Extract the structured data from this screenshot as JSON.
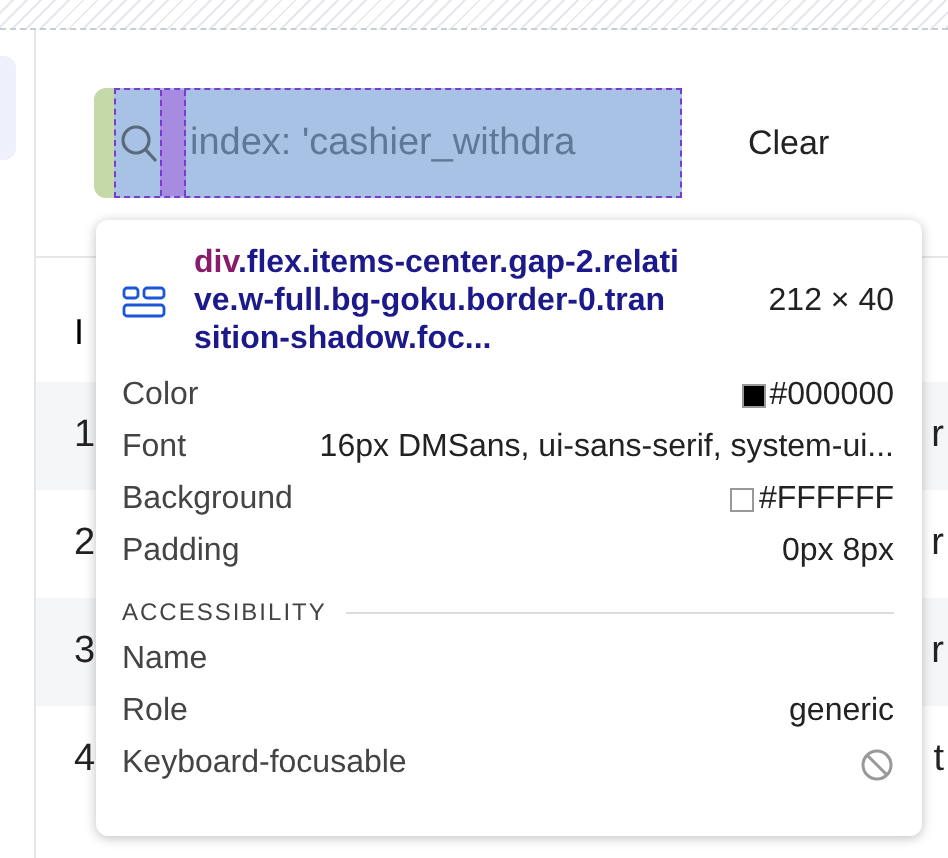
{
  "search": {
    "placeholder": "index: 'cashier_withdra"
  },
  "clear_button": "Clear",
  "table": {
    "columns": [
      "I"
    ],
    "rows": [
      {
        "id": "1",
        "column_2": "r"
      },
      {
        "id": "2",
        "column_2": "r"
      },
      {
        "id": "3",
        "column_2": "r"
      },
      {
        "id": "4",
        "column_2": "t"
      }
    ]
  },
  "inspector": {
    "selector_tag": "div",
    "selector_classes": ".flex.items-center.gap-2.relative.w-full.bg-goku.border-0.transition-shadow.foc...",
    "size": "212 × 40",
    "properties": [
      {
        "label": "Color",
        "value": "#000000",
        "color": "#000000"
      },
      {
        "label": "Font",
        "value": "16px DMSans, ui-sans-serif, system-ui..."
      },
      {
        "label": "Background",
        "value": "#FFFFFF",
        "color": "#ffffff"
      },
      {
        "label": "Padding",
        "value": "0px 8px"
      }
    ],
    "accessibility_heading": "ACCESSIBILITY",
    "accessibility": [
      {
        "label": "Name",
        "kind": "text"
      },
      {
        "label": "Role",
        "kind": "text",
        "value": "generic"
      },
      {
        "label": "Keyboard-focusable",
        "kind": "not-allowed"
      }
    ]
  }
}
